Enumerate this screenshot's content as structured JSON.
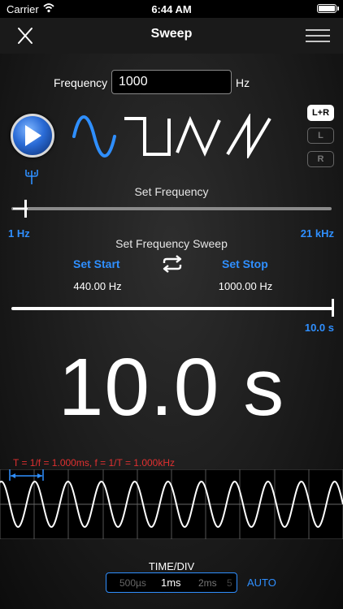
{
  "status_bar": {
    "carrier": "Carrier",
    "time": "6:44 AM"
  },
  "nav": {
    "title": "Sweep",
    "close_icon": "close-icon",
    "menu_icon": "hamburger-menu-icon"
  },
  "frequency": {
    "label": "Frequency",
    "value": "1000",
    "unit": "Hz"
  },
  "waveforms": [
    "sine-wave-icon",
    "square-wave-icon",
    "triangle-wave-icon",
    "sawtooth-wave-icon"
  ],
  "selected_waveform": "sine",
  "channels": {
    "both": "L+R",
    "left": "L",
    "right": "R",
    "selected": "L+R"
  },
  "set_frequency": {
    "label": "Set Frequency",
    "min": "1 Hz",
    "max": "21 kHz",
    "position": 0.04
  },
  "sweep": {
    "label": "Set Frequency Sweep",
    "start_label": "Set Start",
    "stop_label": "Set Stop",
    "start_value": "440.00 Hz",
    "stop_value": "1000.00 Hz",
    "duration_max": "10.0 s",
    "position": 1.0
  },
  "time_display": "10.0 s",
  "scope": {
    "formula": "T = 1/f = 1.000ms, f = 1/T = 1.000kHz"
  },
  "time_div": {
    "label": "TIME/DIV",
    "prev": "500µs",
    "current": "1ms",
    "next": "2ms",
    "edge": "5",
    "auto": "AUTO"
  },
  "colors": {
    "accent": "#2f8fff",
    "formula": "#e03030",
    "background": "#000000"
  }
}
